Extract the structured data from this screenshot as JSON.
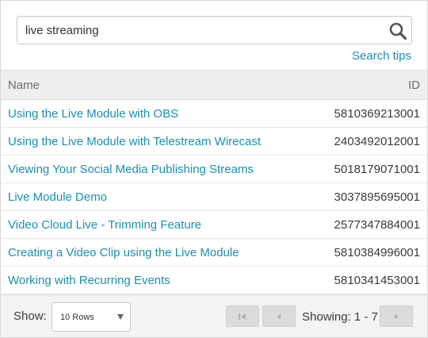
{
  "search": {
    "value": "live streaming",
    "tips_label": "Search tips"
  },
  "table": {
    "headers": {
      "name": "Name",
      "id": "ID"
    },
    "rows": [
      {
        "name": "Using the Live Module with OBS",
        "id": "5810369213001"
      },
      {
        "name": "Using the Live Module with Telestream Wirecast",
        "id": "2403492012001"
      },
      {
        "name": "Viewing Your Social Media Publishing Streams",
        "id": "5018179071001"
      },
      {
        "name": "Live Module Demo",
        "id": "3037895695001"
      },
      {
        "name": "Video Cloud Live - Trimming Feature",
        "id": "2577347884001"
      },
      {
        "name": "Creating a Video Clip using the Live Module",
        "id": "5810384996001"
      },
      {
        "name": "Working with Recurring Events",
        "id": "5810341453001"
      }
    ]
  },
  "footer": {
    "show_label": "Show:",
    "rows_selected": "10 Rows",
    "showing_text": "Showing: 1 - 7",
    "first_icon": "first-page-icon",
    "prev_icon": "previous-page-icon",
    "next_icon": "next-page-icon"
  },
  "colors": {
    "link": "#1a8fb0",
    "header_bg": "#efefef",
    "footer_bg": "#f3f3f3",
    "button_bg": "#dcdcdc"
  }
}
